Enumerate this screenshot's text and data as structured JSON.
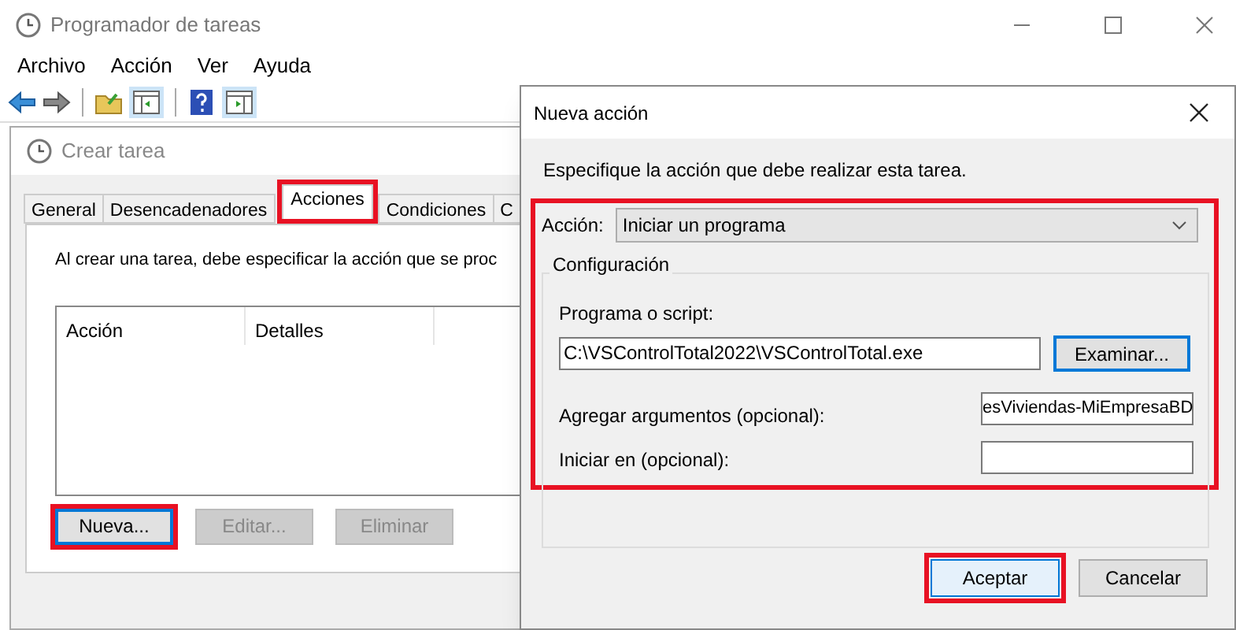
{
  "window": {
    "title": "Programador de tareas"
  },
  "menu": [
    "Archivo",
    "Acción",
    "Ver",
    "Ayuda"
  ],
  "create_task": {
    "title": "Crear tarea",
    "tabs": [
      {
        "label": "General",
        "selected": false,
        "highlighted": false
      },
      {
        "label": "Desencadenadores",
        "selected": false,
        "highlighted": false
      },
      {
        "label": "Acciones",
        "selected": true,
        "highlighted": true
      },
      {
        "label": "Condiciones",
        "selected": false,
        "highlighted": false
      },
      {
        "label": "C",
        "selected": false,
        "highlighted": false
      }
    ],
    "description": "Al crear una tarea, debe especificar la acción que se proc",
    "actions_list": {
      "columns": [
        "Acción",
        "Detalles"
      ]
    },
    "buttons": [
      {
        "label": "Nueva...",
        "disabled": false,
        "focused": true,
        "highlighted": true
      },
      {
        "label": "Editar...",
        "disabled": true,
        "focused": false,
        "highlighted": false
      },
      {
        "label": "Eliminar",
        "disabled": true,
        "focused": false,
        "highlighted": false
      }
    ]
  },
  "dialog": {
    "title": "Nueva acción",
    "instruction": "Especifique la acción que debe realizar esta tarea.",
    "action_section_highlighted": true,
    "action_label": "Acción:",
    "action_value": "Iniciar un programa",
    "group_title": "Configuración",
    "program_label": "Programa o script:",
    "program_value": "C:\\VSControlTotal2022\\VSControlTotal.exe",
    "browse_button": {
      "label": "Examinar...",
      "focused": true
    },
    "arguments_label": "Agregar argumentos (opcional):",
    "arguments_value": "esViviendas-MiEmpresaBD",
    "start_in_label": "Iniciar en (opcional):",
    "buttons": [
      {
        "label": "Aceptar",
        "default": true,
        "highlighted": true
      },
      {
        "label": "Cancelar",
        "default": false,
        "highlighted": false
      }
    ]
  }
}
